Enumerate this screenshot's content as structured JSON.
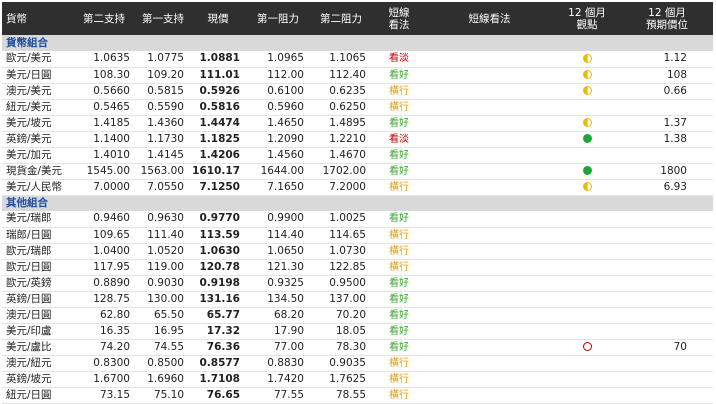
{
  "colors": {
    "header_bg": "#2f2f2f",
    "group_bg": "#d9d9d9",
    "group_text": "#1f4e9c",
    "strong_bull": "#c00000",
    "bull": "#39a82f",
    "neutral": "#e8a000",
    "ind_full": "#21a33a",
    "ind_half": "#f2b800",
    "ind_ring": "#c00000"
  },
  "header": {
    "asset": "貨幣",
    "support2": "第二支持",
    "support1": "第一支持",
    "current": "現價",
    "resist1": "第一阻力",
    "resist2": "第二阻力",
    "short_view_l1": "短線",
    "short_view_l2": "看法",
    "short_view_text": "短線看法",
    "m12_view_l1": "12 個月",
    "m12_view_l2": "觀點",
    "m12_target_l1": "12 個月",
    "m12_target_l2": "預期價位"
  },
  "groups": [
    {
      "title": "貨幣組合",
      "rows": [
        {
          "name": "歐元/美元",
          "s2": "1.0635",
          "s1": "1.0775",
          "cur": "1.0881",
          "r1": "1.0965",
          "r2": "1.1065",
          "view": "看淡",
          "view_class": "v-strong",
          "ind": "half",
          "target": "1.12"
        },
        {
          "name": "美元/日圓",
          "s2": "108.30",
          "s1": "109.20",
          "cur": "111.01",
          "r1": "112.00",
          "r2": "112.40",
          "view": "看好",
          "view_class": "v-bull",
          "ind": "half",
          "target": "108"
        },
        {
          "name": "澳元/美元",
          "s2": "0.5660",
          "s1": "0.5815",
          "cur": "0.5926",
          "r1": "0.6100",
          "r2": "0.6235",
          "view": "橫行",
          "view_class": "v-neut",
          "ind": "half",
          "target": "0.66"
        },
        {
          "name": "紐元/美元",
          "s2": "0.5465",
          "s1": "0.5590",
          "cur": "0.5816",
          "r1": "0.5960",
          "r2": "0.6250",
          "view": "橫行",
          "view_class": "v-neut",
          "ind": "",
          "target": ""
        },
        {
          "name": "美元/坡元",
          "s2": "1.4185",
          "s1": "1.4360",
          "cur": "1.4474",
          "r1": "1.4650",
          "r2": "1.4895",
          "view": "看好",
          "view_class": "v-bull",
          "ind": "half",
          "target": "1.37"
        },
        {
          "name": "英鎊/美元",
          "s2": "1.1400",
          "s1": "1.1730",
          "cur": "1.1825",
          "r1": "1.2090",
          "r2": "1.2210",
          "view": "看淡",
          "view_class": "v-strong",
          "ind": "full",
          "target": "1.38"
        },
        {
          "name": "美元/加元",
          "s2": "1.4010",
          "s1": "1.4145",
          "cur": "1.4206",
          "r1": "1.4560",
          "r2": "1.4670",
          "view": "看好",
          "view_class": "v-bull",
          "ind": "",
          "target": ""
        },
        {
          "name": "現貨金/美元",
          "s2": "1545.00",
          "s1": "1563.00",
          "cur": "1610.17",
          "r1": "1644.00",
          "r2": "1702.00",
          "view": "看好",
          "view_class": "v-bull",
          "ind": "full",
          "target": "1800"
        },
        {
          "name": "美元/人民幣",
          "s2": "7.0000",
          "s1": "7.0550",
          "cur": "7.1250",
          "r1": "7.1650",
          "r2": "7.2000",
          "view": "橫行",
          "view_class": "v-neut",
          "ind": "half",
          "target": "6.93"
        }
      ]
    },
    {
      "title": "其他組合",
      "rows": [
        {
          "name": "美元/瑞郎",
          "s2": "0.9460",
          "s1": "0.9630",
          "cur": "0.9770",
          "r1": "0.9900",
          "r2": "1.0025",
          "view": "看好",
          "view_class": "v-bull",
          "ind": "",
          "target": ""
        },
        {
          "name": "瑞郎/日圓",
          "s2": "109.65",
          "s1": "111.40",
          "cur": "113.59",
          "r1": "114.40",
          "r2": "114.65",
          "view": "橫行",
          "view_class": "v-neut",
          "ind": "",
          "target": ""
        },
        {
          "name": "歐元/瑞郎",
          "s2": "1.0400",
          "s1": "1.0520",
          "cur": "1.0630",
          "r1": "1.0650",
          "r2": "1.0730",
          "view": "橫行",
          "view_class": "v-neut",
          "ind": "",
          "target": ""
        },
        {
          "name": "歐元/日圓",
          "s2": "117.95",
          "s1": "119.00",
          "cur": "120.78",
          "r1": "121.30",
          "r2": "122.85",
          "view": "橫行",
          "view_class": "v-neut",
          "ind": "",
          "target": ""
        },
        {
          "name": "歐元/英鎊",
          "s2": "0.8890",
          "s1": "0.9030",
          "cur": "0.9198",
          "r1": "0.9325",
          "r2": "0.9500",
          "view": "看好",
          "view_class": "v-bull",
          "ind": "",
          "target": ""
        },
        {
          "name": "英鎊/日圓",
          "s2": "128.75",
          "s1": "130.00",
          "cur": "131.16",
          "r1": "134.50",
          "r2": "137.00",
          "view": "看好",
          "view_class": "v-bull",
          "ind": "",
          "target": ""
        },
        {
          "name": "澳元/日圓",
          "s2": "62.80",
          "s1": "65.50",
          "cur": "65.77",
          "r1": "68.20",
          "r2": "70.20",
          "view": "看好",
          "view_class": "v-bull",
          "ind": "",
          "target": ""
        },
        {
          "name": "美元/印盧",
          "s2": "16.35",
          "s1": "16.95",
          "cur": "17.32",
          "r1": "17.90",
          "r2": "18.05",
          "view": "看好",
          "view_class": "v-bull",
          "ind": "",
          "target": ""
        },
        {
          "name": "美元/盧比",
          "s2": "74.20",
          "s1": "74.55",
          "cur": "76.36",
          "r1": "77.00",
          "r2": "78.30",
          "view": "看好",
          "view_class": "v-bull",
          "ind": "ring",
          "target": "70"
        },
        {
          "name": "澳元/紐元",
          "s2": "0.8300",
          "s1": "0.8500",
          "cur": "0.8577",
          "r1": "0.8830",
          "r2": "0.9035",
          "view": "橫行",
          "view_class": "v-neut",
          "ind": "",
          "target": ""
        },
        {
          "name": "英鎊/坡元",
          "s2": "1.6700",
          "s1": "1.6960",
          "cur": "1.7108",
          "r1": "1.7420",
          "r2": "1.7625",
          "view": "橫行",
          "view_class": "v-neut",
          "ind": "",
          "target": ""
        },
        {
          "name": "紐元/日圓",
          "s2": "73.15",
          "s1": "75.10",
          "cur": "76.65",
          "r1": "77.55",
          "r2": "78.55",
          "view": "橫行",
          "view_class": "v-neut",
          "ind": "",
          "target": ""
        }
      ]
    }
  ]
}
